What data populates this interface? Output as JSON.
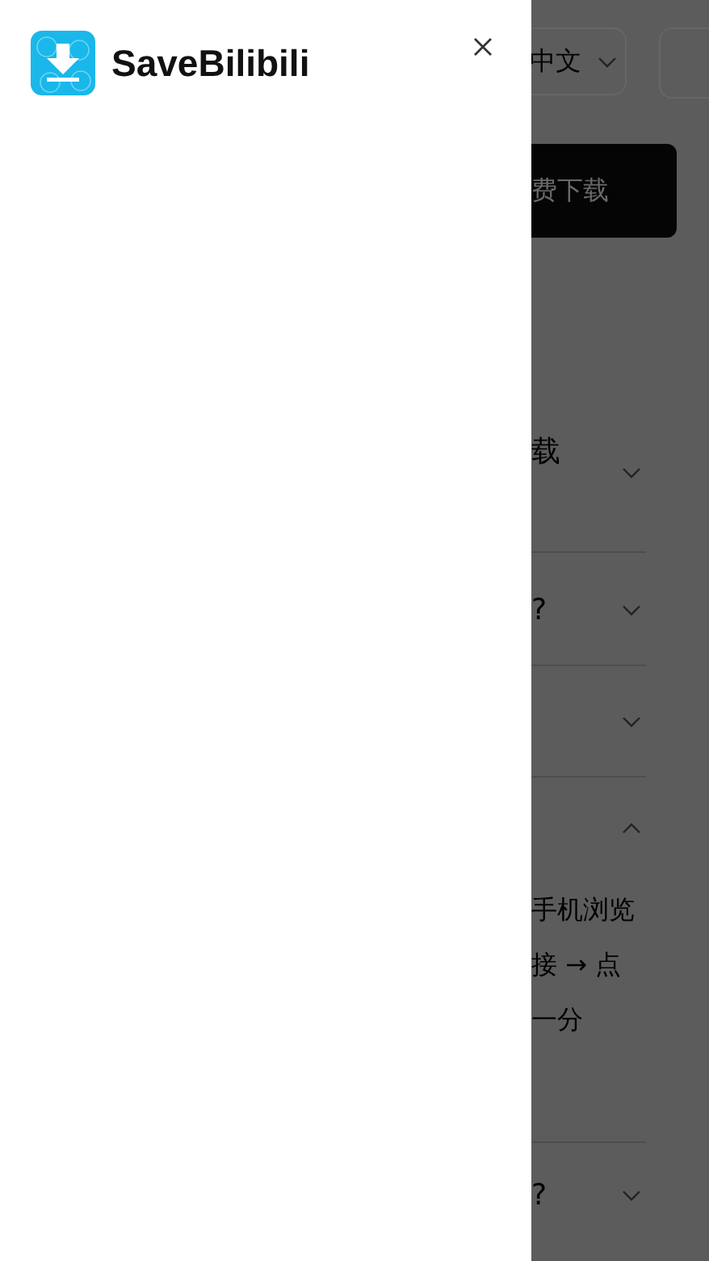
{
  "drawer": {
    "brand": "SaveBilibili"
  },
  "background": {
    "language": "中文",
    "download_button": "费下载",
    "faq": [
      {
        "question": "载",
        "expanded": false
      },
      {
        "question": "?",
        "expanded": false
      },
      {
        "expanded": false
      },
      {
        "expanded": true,
        "answer_lines": [
          "手机浏览",
          "接 → 点",
          "一分"
        ]
      },
      {
        "question": "?",
        "expanded": false
      }
    ]
  }
}
